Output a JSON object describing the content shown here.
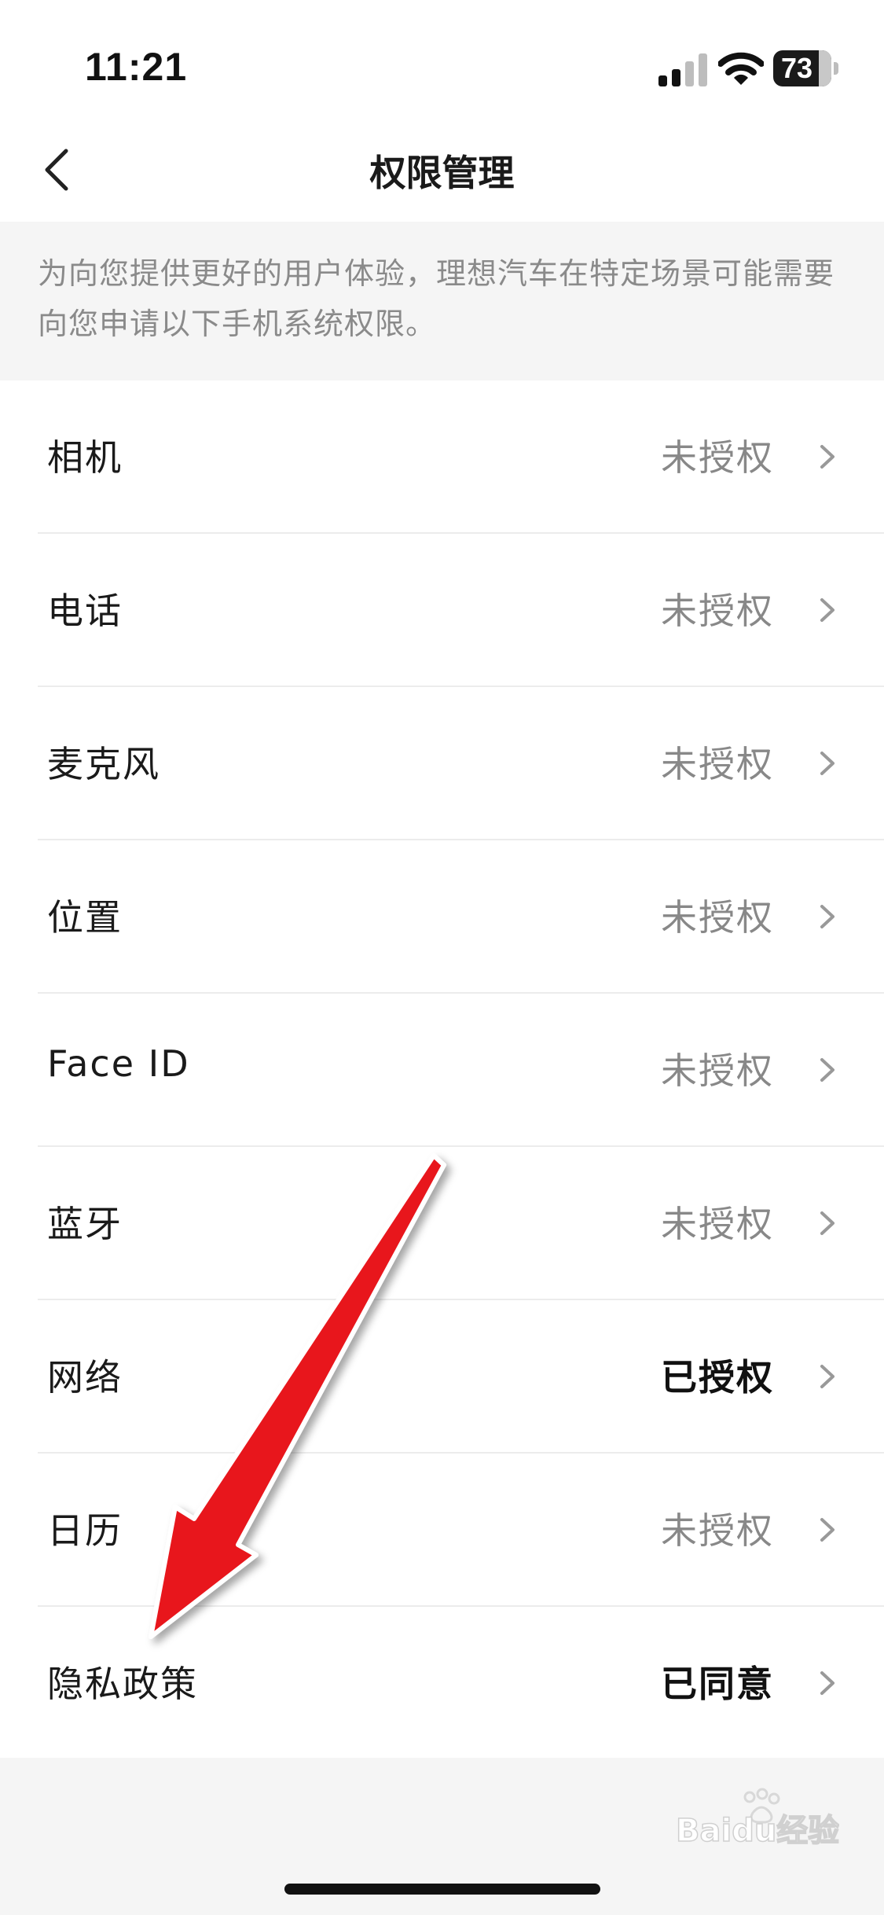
{
  "status_bar": {
    "time": "11:21",
    "battery_level": "73"
  },
  "nav": {
    "title": "权限管理"
  },
  "description": "为向您提供更好的用户体验，理想汽车在特定场景可能需要向您申请以下手机系统权限。",
  "permissions": [
    {
      "label": "相机",
      "status": "未授权",
      "granted": false
    },
    {
      "label": "电话",
      "status": "未授权",
      "granted": false
    },
    {
      "label": "麦克风",
      "status": "未授权",
      "granted": false
    },
    {
      "label": "位置",
      "status": "未授权",
      "granted": false
    },
    {
      "label": "Face ID",
      "status": "未授权",
      "granted": false
    },
    {
      "label": "蓝牙",
      "status": "未授权",
      "granted": false
    },
    {
      "label": "网络",
      "status": "已授权",
      "granted": true
    },
    {
      "label": "日历",
      "status": "未授权",
      "granted": false
    },
    {
      "label": "隐私政策",
      "status": "已同意",
      "granted": true
    }
  ],
  "watermark": "Baidu经验",
  "colors": {
    "page_background": "#f5f5f5",
    "annotation_arrow": "#ee1111",
    "muted_text": "#888888"
  }
}
